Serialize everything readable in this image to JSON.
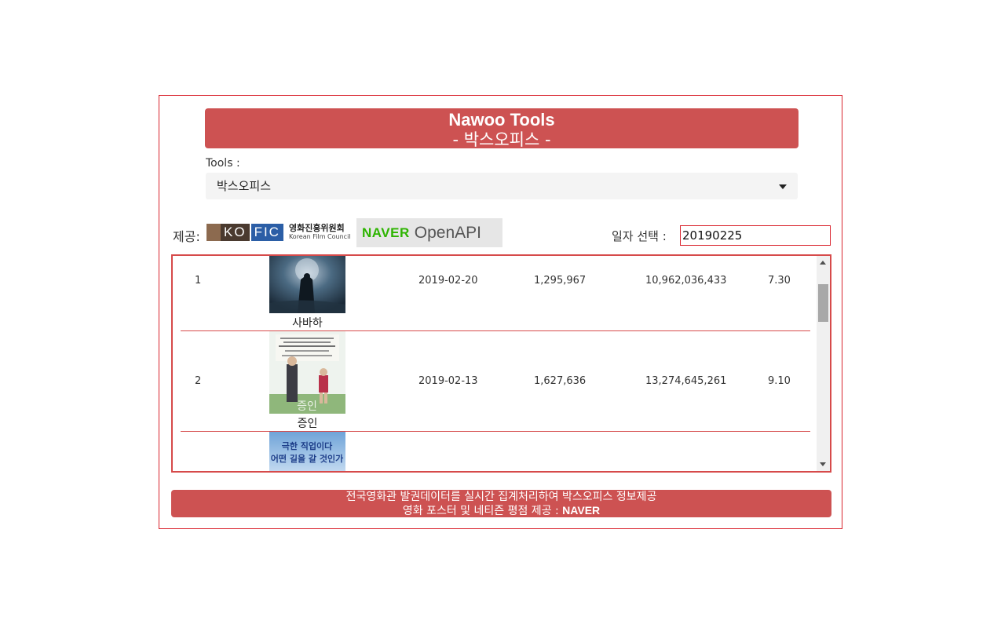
{
  "header": {
    "title": "Nawoo Tools",
    "subtitle": "- 박스오피스 -"
  },
  "tools": {
    "label": "Tools :",
    "selected": "박스오피스"
  },
  "provider": {
    "label": "제공:",
    "kofic_ko": "KO",
    "kofic_fic": "FIC",
    "kofic_name_ko": "영화진흥위원회",
    "kofic_name_en": "Korean Film Council",
    "naver_brand": "NAVER",
    "naver_product": "OpenAPI"
  },
  "date": {
    "label": "일자 선택 :",
    "value": "20190225"
  },
  "movies": [
    {
      "rank": "1",
      "title": "사바하",
      "release_date": "2019-02-20",
      "audience": "1,295,967",
      "sales": "10,962,036,433",
      "rating": "7.30"
    },
    {
      "rank": "2",
      "title": "증인",
      "release_date": "2019-02-13",
      "audience": "1,627,636",
      "sales": "13,274,645,261",
      "rating": "9.10"
    },
    {
      "rank": "",
      "title": "",
      "release_date": "",
      "audience": "",
      "sales": "",
      "rating": ""
    }
  ],
  "poster_texts": {
    "movie3_line1": "극한 직업이다",
    "movie3_line2": "어떤 길을 갈 것인가"
  },
  "footer": {
    "line1": "전국영화관 발권데이터를 실시간 집계처리하여 박스오피스 정보제공",
    "line2_prefix": "영화 포스터 및 네티즌 평점 제공 : ",
    "line2_brand": "NAVER"
  },
  "colors": {
    "accent": "#cd5252",
    "border": "#d9232d",
    "naver_green": "#2db400"
  }
}
